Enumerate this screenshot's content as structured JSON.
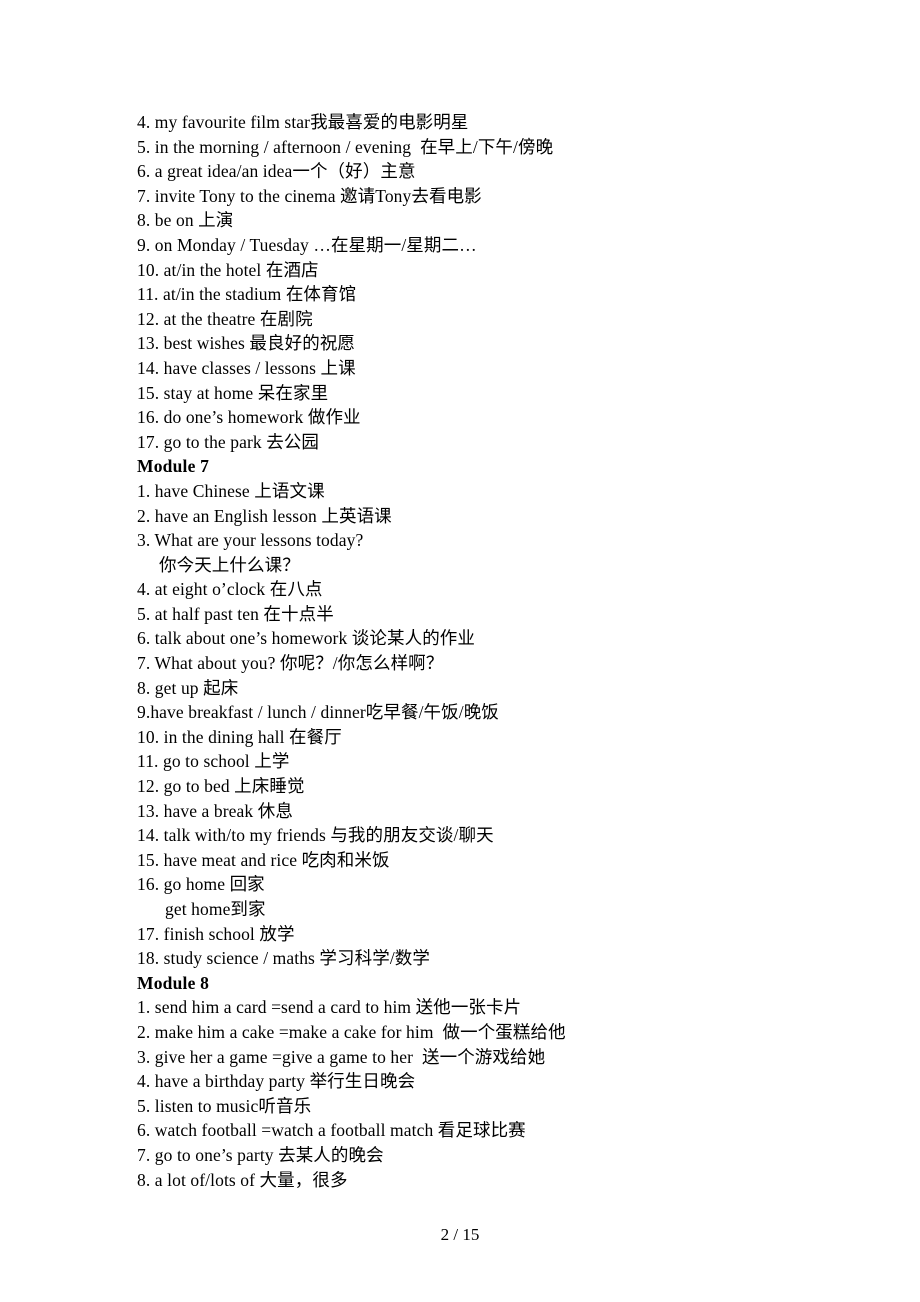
{
  "document": {
    "page_footer": "2 / 15",
    "lines": [
      {
        "text": "4. my favourite film star我最喜爱的电影明星",
        "style": "normal",
        "name": "vocab-line-m6-4"
      },
      {
        "text": "5. in the morning / afternoon / evening  在早上/下午/傍晚",
        "style": "normal",
        "name": "vocab-line-m6-5"
      },
      {
        "text": "6. a great idea/an idea一个（好）主意",
        "style": "normal",
        "name": "vocab-line-m6-6"
      },
      {
        "text": "7. invite Tony to the cinema 邀请Tony去看电影",
        "style": "normal",
        "name": "vocab-line-m6-7"
      },
      {
        "text": "8. be on 上演",
        "style": "normal",
        "name": "vocab-line-m6-8"
      },
      {
        "text": "9. on Monday / Tuesday …在星期一/星期二…",
        "style": "normal",
        "name": "vocab-line-m6-9"
      },
      {
        "text": "10. at/in the hotel 在酒店",
        "style": "normal",
        "name": "vocab-line-m6-10"
      },
      {
        "text": "11. at/in the stadium 在体育馆",
        "style": "normal",
        "name": "vocab-line-m6-11"
      },
      {
        "text": "12. at the theatre 在剧院",
        "style": "normal",
        "name": "vocab-line-m6-12"
      },
      {
        "text": "13. best wishes 最良好的祝愿",
        "style": "normal",
        "name": "vocab-line-m6-13"
      },
      {
        "text": "14. have classes / lessons 上课",
        "style": "normal",
        "name": "vocab-line-m6-14"
      },
      {
        "text": "15. stay at home 呆在家里",
        "style": "normal",
        "name": "vocab-line-m6-15"
      },
      {
        "text": "16. do one’s homework 做作业",
        "style": "normal",
        "name": "vocab-line-m6-16"
      },
      {
        "text": "17. go to the park 去公园",
        "style": "normal",
        "name": "vocab-line-m6-17"
      },
      {
        "text": "Module 7",
        "style": "module-head",
        "name": "module-heading-7"
      },
      {
        "text": "1. have Chinese 上语文课",
        "style": "normal",
        "name": "vocab-line-m7-1"
      },
      {
        "text": "2. have an English lesson 上英语课",
        "style": "normal",
        "name": "vocab-line-m7-2"
      },
      {
        "text": "3. What are your lessons today?",
        "style": "normal",
        "name": "vocab-line-m7-3"
      },
      {
        "text": "你今天上什么课？",
        "style": "cont-1",
        "name": "vocab-line-m7-3-translation"
      },
      {
        "text": "4. at eight o’clock 在八点",
        "style": "normal",
        "name": "vocab-line-m7-4"
      },
      {
        "text": "5. at half past ten 在十点半",
        "style": "normal",
        "name": "vocab-line-m7-5"
      },
      {
        "text": "6. talk about one’s homework 谈论某人的作业",
        "style": "normal",
        "name": "vocab-line-m7-6"
      },
      {
        "text": "7. What about you? 你呢？/你怎么样啊？",
        "style": "normal",
        "name": "vocab-line-m7-7"
      },
      {
        "text": "8. get up 起床",
        "style": "normal",
        "name": "vocab-line-m7-8"
      },
      {
        "text": "9.have breakfast / lunch / dinner吃早餐/午饭/晚饭",
        "style": "normal",
        "name": "vocab-line-m7-9"
      },
      {
        "text": "10. in the dining hall 在餐厅",
        "style": "normal",
        "name": "vocab-line-m7-10"
      },
      {
        "text": "11. go to school 上学",
        "style": "normal",
        "name": "vocab-line-m7-11"
      },
      {
        "text": "12. go to bed 上床睡觉",
        "style": "normal",
        "name": "vocab-line-m7-12"
      },
      {
        "text": "13. have a break 休息",
        "style": "normal",
        "name": "vocab-line-m7-13"
      },
      {
        "text": "14. talk with/to my friends 与我的朋友交谈/聊天",
        "style": "normal",
        "name": "vocab-line-m7-14"
      },
      {
        "text": "15. have meat and rice 吃肉和米饭",
        "style": "normal",
        "name": "vocab-line-m7-15"
      },
      {
        "text": "16. go home 回家",
        "style": "normal",
        "name": "vocab-line-m7-16"
      },
      {
        "text": "get home到家",
        "style": "cont-2",
        "name": "vocab-line-m7-16-alt"
      },
      {
        "text": "17. finish school 放学",
        "style": "normal",
        "name": "vocab-line-m7-17"
      },
      {
        "text": "18. study science / maths 学习科学/数学",
        "style": "normal",
        "name": "vocab-line-m7-18"
      },
      {
        "text": "Module 8",
        "style": "module-head",
        "name": "module-heading-8"
      },
      {
        "text": "1. send him a card =send a card to him 送他一张卡片",
        "style": "normal",
        "name": "vocab-line-m8-1"
      },
      {
        "text": "2. make him a cake =make a cake for him  做一个蛋糕给他",
        "style": "normal",
        "name": "vocab-line-m8-2"
      },
      {
        "text": "3. give her a game =give a game to her  送一个游戏给她",
        "style": "normal",
        "name": "vocab-line-m8-3"
      },
      {
        "text": "4. have a birthday party 举行生日晚会",
        "style": "normal",
        "name": "vocab-line-m8-4"
      },
      {
        "text": "5. listen to music听音乐",
        "style": "normal",
        "name": "vocab-line-m8-5"
      },
      {
        "text": "6. watch football =watch a football match 看足球比赛",
        "style": "normal",
        "name": "vocab-line-m8-6"
      },
      {
        "text": "7. go to one’s party 去某人的晚会",
        "style": "normal",
        "name": "vocab-line-m8-7"
      },
      {
        "text": "8. a lot of/lots of 大量，很多",
        "style": "normal",
        "name": "vocab-line-m8-8"
      }
    ]
  }
}
